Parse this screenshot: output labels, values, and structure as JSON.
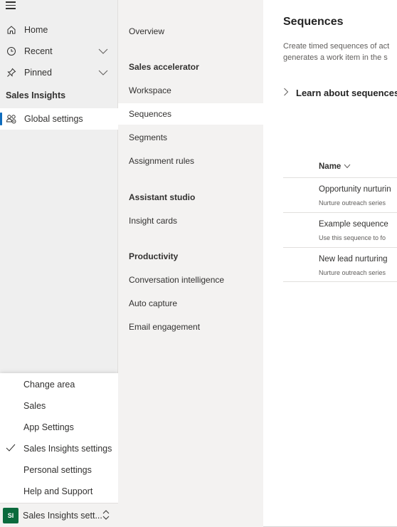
{
  "left_nav": {
    "items": [
      {
        "label": "Home",
        "icon": "home-icon"
      },
      {
        "label": "Recent",
        "icon": "clock-icon"
      },
      {
        "label": "Pinned",
        "icon": "pin-icon"
      }
    ],
    "section_label": "Sales Insights",
    "selected_item": {
      "label": "Global settings",
      "icon": "settings-people-icon"
    }
  },
  "area_flyout": {
    "items": [
      {
        "label": "Change area"
      },
      {
        "label": "Sales"
      },
      {
        "label": "App Settings"
      },
      {
        "label": "Sales Insights settings",
        "checked": true
      },
      {
        "label": "Personal settings"
      },
      {
        "label": "Help and Support"
      }
    ]
  },
  "area_switcher": {
    "avatar_text": "SI",
    "avatar_color": "#0b6a3d",
    "label": "Sales Insights sett..."
  },
  "settings_nav": {
    "overview": "Overview",
    "sections": [
      {
        "heading": "Sales accelerator",
        "items": [
          "Workspace",
          "Sequences",
          "Segments",
          "Assignment rules"
        ]
      },
      {
        "heading": "Assistant studio",
        "items": [
          "Insight cards"
        ]
      },
      {
        "heading": "Productivity",
        "items": [
          "Conversation intelligence",
          "Auto capture",
          "Email engagement"
        ]
      }
    ],
    "active_item": "Sequences"
  },
  "main": {
    "title": "Sequences",
    "description_line1": "Create timed sequences of act",
    "description_line2": "generates a work item in the s",
    "learn_more": "Learn about sequences",
    "table": {
      "column_name": "Name",
      "rows": [
        {
          "name": "Opportunity nurturin",
          "description": "Nurture outreach series"
        },
        {
          "name": "Example sequence",
          "description": "Use this sequence to fo"
        },
        {
          "name": "New lead nurturing",
          "description": "Nurture outreach series"
        }
      ]
    }
  },
  "colors": {
    "accent": "#0f6cbd",
    "nav_bg": "#efefef",
    "settings_bg": "#f3f2f1"
  }
}
